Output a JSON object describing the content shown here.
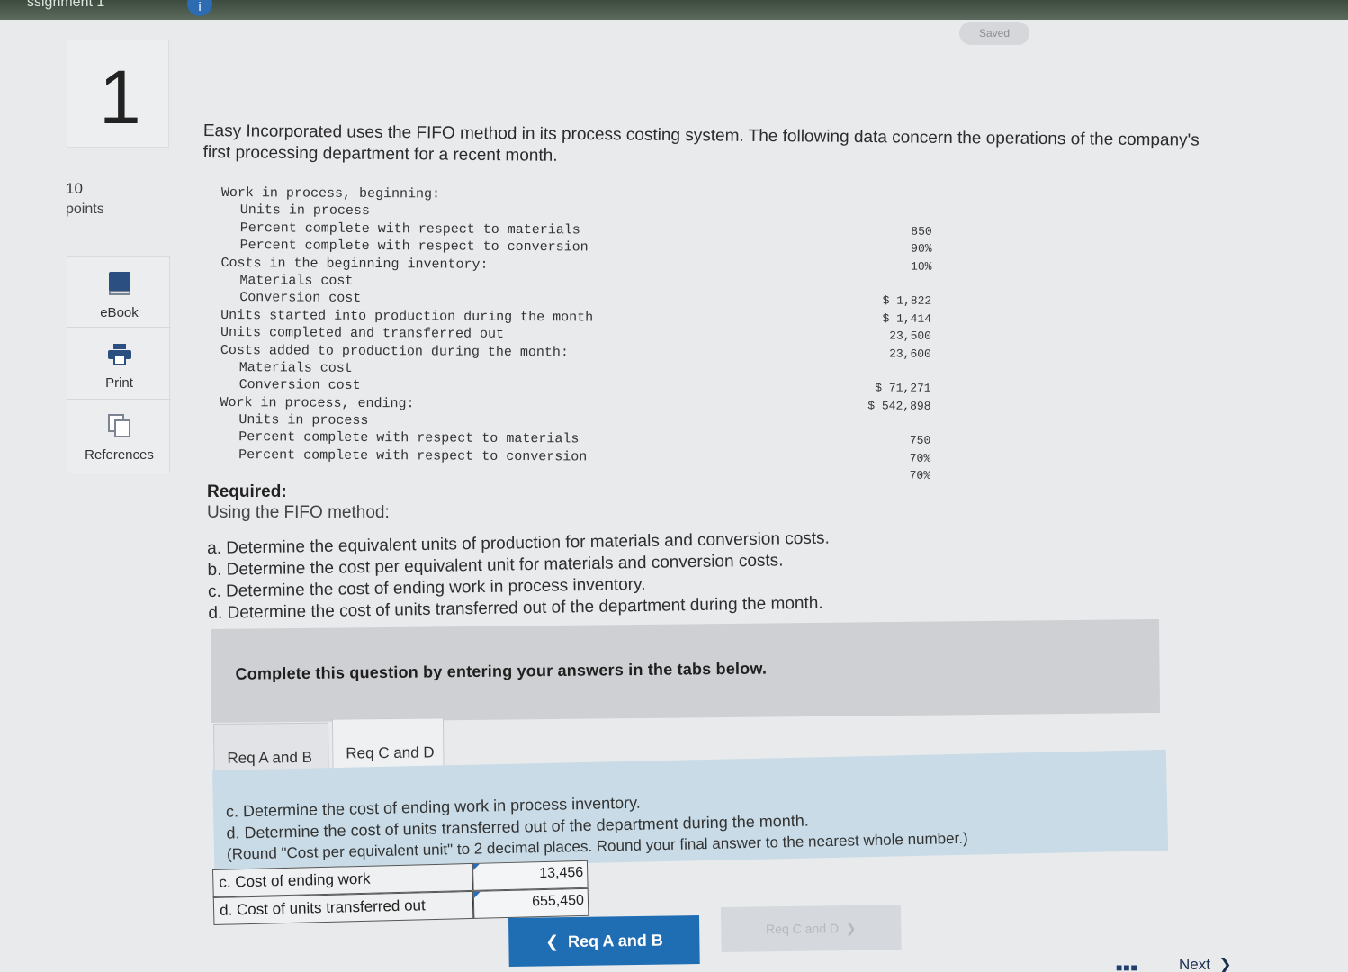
{
  "header": {
    "title_fragment": "ssignment 1",
    "badge": "i",
    "saved_label": "Saved"
  },
  "question": {
    "number": "1",
    "points_value": "10",
    "points_label": "points"
  },
  "sidebar": {
    "items": [
      {
        "label": "eBook",
        "icon": "book-icon"
      },
      {
        "label": "Print",
        "icon": "printer-icon"
      },
      {
        "label": "References",
        "icon": "copy-icon"
      }
    ]
  },
  "intro": "Easy Incorporated uses the FIFO method in its process costing system. The following data concern the operations of the company's first processing department for a recent month.",
  "data_rows": [
    {
      "label": "Work in process, beginning:",
      "value": "",
      "indent": 0
    },
    {
      "label": "Units in process",
      "value": "",
      "indent": 1
    },
    {
      "label": "Percent complete with respect to materials",
      "value": "850",
      "indent": 1
    },
    {
      "label": "Percent complete with respect to conversion",
      "value": "90%",
      "indent": 1
    },
    {
      "label": "Costs in the beginning inventory:",
      "value": "10%",
      "indent": 0
    },
    {
      "label": "Materials cost",
      "value": "",
      "indent": 1
    },
    {
      "label": "Conversion cost",
      "value": "$ 1,822",
      "indent": 1
    },
    {
      "label": "Units started into production during the month",
      "value": "$ 1,414",
      "indent": 0
    },
    {
      "label": "Units completed and transferred out",
      "value": "23,500",
      "indent": 0
    },
    {
      "label": "Costs added to production during the month:",
      "value": "23,600",
      "indent": 0
    },
    {
      "label": "Materials cost",
      "value": "",
      "indent": 1
    },
    {
      "label": "Conversion cost",
      "value": "$ 71,271",
      "indent": 1
    },
    {
      "label": "Work in process, ending:",
      "value": "$ 542,898",
      "indent": 0
    },
    {
      "label": "Units in process",
      "value": "",
      "indent": 1
    },
    {
      "label": "Percent complete with respect to materials",
      "value": "750",
      "indent": 1
    },
    {
      "label": "Percent complete with respect to conversion",
      "value": "70%",
      "indent": 1
    },
    {
      "label": "",
      "value": "70%",
      "indent": 1
    }
  ],
  "required": {
    "heading": "Required:",
    "subheading": "Using the FIFO method:",
    "tasks": [
      "a. Determine the equivalent units of production for materials and conversion costs.",
      "b. Determine the cost per equivalent unit for materials and conversion costs.",
      "c. Determine the cost of ending work in process inventory.",
      "d. Determine the cost of units transferred out of the department during the month."
    ]
  },
  "instructions": "Complete this question by entering your answers in the tabs below.",
  "tabs": [
    {
      "label": "Req A and B",
      "active": false
    },
    {
      "label": "Req C and D",
      "active": true
    }
  ],
  "answer_panel": {
    "lines": [
      "c. Determine the cost of ending work in process inventory.",
      "d. Determine the cost of units transferred out of the department during the month.",
      "(Round \"Cost per equivalent unit\" to 2 decimal places. Round your final answer to the nearest whole number.)"
    ]
  },
  "answers": [
    {
      "label": "c. Cost of ending work",
      "value": "13,456"
    },
    {
      "label": "d. Cost of units transferred out",
      "value": "655,450"
    }
  ],
  "nav": {
    "prev_label": "Req A and B",
    "next_label": "Req C and D",
    "footer_next": "Next"
  }
}
